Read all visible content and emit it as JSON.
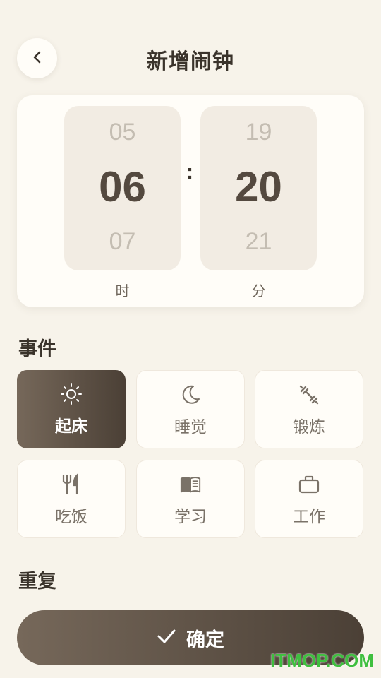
{
  "header": {
    "title": "新增闹钟",
    "back_icon": "chevron-left-icon"
  },
  "time_picker": {
    "hour": {
      "prev": "05",
      "current": "06",
      "next": "07",
      "label": "时"
    },
    "minute": {
      "prev": "19",
      "current": "20",
      "next": "21",
      "label": "分"
    },
    "separator": ":"
  },
  "events": {
    "title": "事件",
    "items": [
      {
        "label": "起床",
        "icon": "sun-icon",
        "selected": true
      },
      {
        "label": "睡觉",
        "icon": "moon-icon",
        "selected": false
      },
      {
        "label": "锻炼",
        "icon": "dumbbell-icon",
        "selected": false
      },
      {
        "label": "吃饭",
        "icon": "utensils-icon",
        "selected": false
      },
      {
        "label": "学习",
        "icon": "book-icon",
        "selected": false
      },
      {
        "label": "工作",
        "icon": "briefcase-icon",
        "selected": false
      }
    ]
  },
  "repeat": {
    "title": "重复"
  },
  "confirm": {
    "label": "确定",
    "icon": "check-icon"
  },
  "watermark": "ITMOP.COM",
  "colors": {
    "accent_start": "#76685a",
    "accent_end": "#4b4036",
    "background": "#f7f3ea",
    "watermark": "#3fbf3f"
  }
}
